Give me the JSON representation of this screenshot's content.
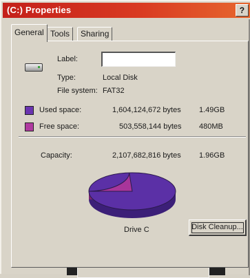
{
  "window": {
    "title": "(C:) Properties",
    "help_label": "?"
  },
  "tabs": [
    {
      "label": "General",
      "active": true
    },
    {
      "label": "Tools",
      "active": false
    },
    {
      "label": "Sharing",
      "active": false
    }
  ],
  "general": {
    "label_caption": "Label:",
    "label_value": "",
    "type_caption": "Type:",
    "type_value": "Local Disk",
    "fs_caption": "File system:",
    "fs_value": "FAT32",
    "used": {
      "caption": "Used space:",
      "bytes": "1,604,124,672 bytes",
      "size": "1.49GB",
      "color": "#6a34b0"
    },
    "free": {
      "caption": "Free space:",
      "bytes": "503,558,144 bytes",
      "size": "480MB",
      "color": "#b03aa0"
    },
    "capacity": {
      "caption": "Capacity:",
      "bytes": "2,107,682,816 bytes",
      "size": "1.96GB"
    },
    "drive_caption": "Drive C",
    "cleanup_label": "Disk Cleanup..."
  },
  "pie": {
    "used_fraction": 0.761,
    "free_fraction": 0.239
  }
}
